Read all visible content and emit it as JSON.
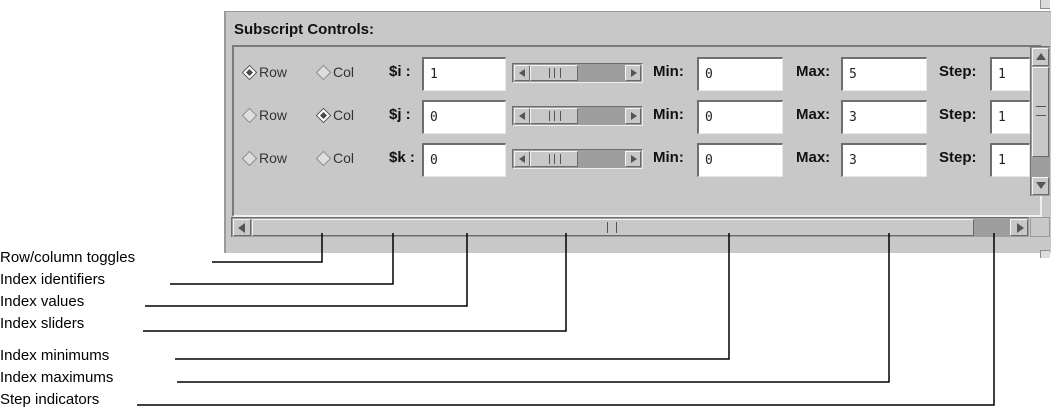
{
  "panel": {
    "title": "Subscript Controls:",
    "rows": [
      {
        "row_label": "Row",
        "col_label": "Col",
        "row_selected": true,
        "col_selected": false,
        "index": "$i :",
        "value": "1",
        "min_label": "Min:",
        "min": "0",
        "max_label": "Max:",
        "max": "5",
        "step_label": "Step:",
        "step": "1"
      },
      {
        "row_label": "Row",
        "col_label": "Col",
        "row_selected": false,
        "col_selected": true,
        "index": "$j :",
        "value": "0",
        "min_label": "Min:",
        "min": "0",
        "max_label": "Max:",
        "max": "3",
        "step_label": "Step:",
        "step": "1"
      },
      {
        "row_label": "Row",
        "col_label": "Col",
        "row_selected": false,
        "col_selected": false,
        "index": "$k :",
        "value": "0",
        "min_label": "Min:",
        "min": "0",
        "max_label": "Max:",
        "max": "3",
        "step_label": "Step:",
        "step": "1"
      }
    ]
  },
  "callouts": [
    {
      "label": "Row/column toggles"
    },
    {
      "label": "Index identifiers"
    },
    {
      "label": "Index values"
    },
    {
      "label": "Index sliders"
    },
    {
      "label": "Index minimums"
    },
    {
      "label": "Index maximums"
    },
    {
      "label": "Step indicators"
    }
  ],
  "colors": {
    "panel": "#c8c8c8",
    "leader_line": "#000000"
  }
}
